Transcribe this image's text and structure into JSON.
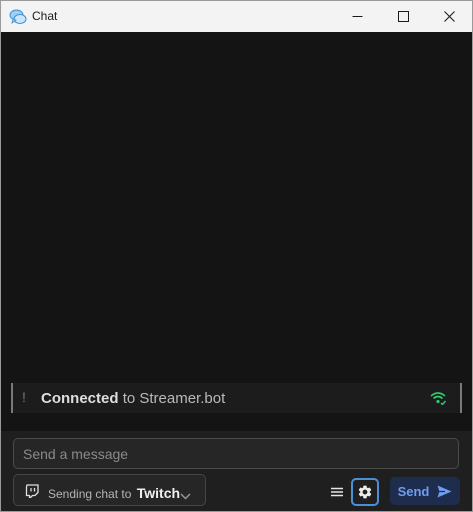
{
  "window": {
    "title": "Chat"
  },
  "icons": {
    "app": "chat-bubbles-icon",
    "minimize": "minimize-icon",
    "maximize": "maximize-icon",
    "close": "close-icon",
    "platform": "twitch-icon",
    "connection": "wifi-connected-icon",
    "menu": "hamburger-menu-icon",
    "settings": "gear-icon",
    "send": "paper-plane-icon"
  },
  "status": {
    "prefix": "!",
    "connected": "Connected",
    "suffix": "to Streamer.bot",
    "connected_color": "#2ecc71"
  },
  "composer": {
    "placeholder": "Send a message",
    "value": ""
  },
  "platform_selector": {
    "prefix": "Sending chat to",
    "platform": "Twitch"
  },
  "actions": {
    "send_label": "Send",
    "accent_color": "#6f9df0"
  }
}
